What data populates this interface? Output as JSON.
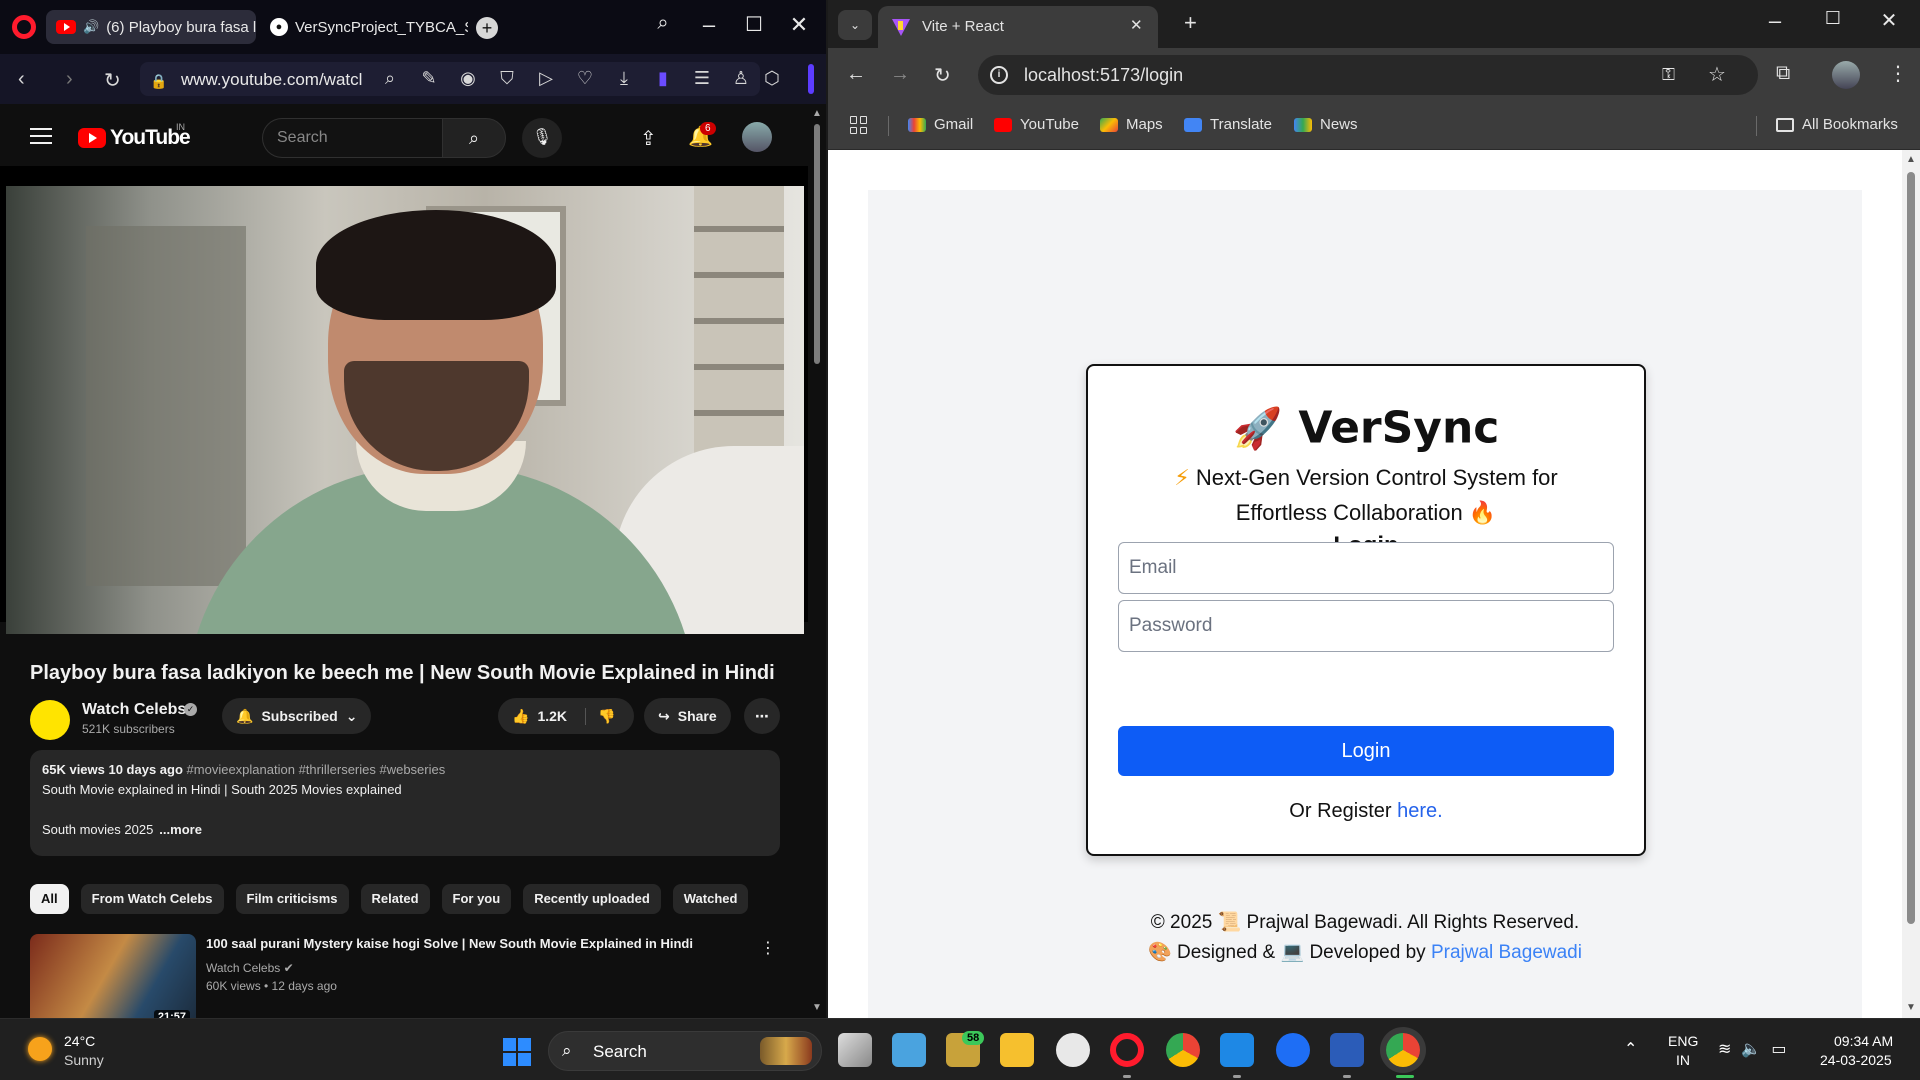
{
  "opera": {
    "tabs": [
      {
        "label": "(6) Playboy bura fasa l"
      },
      {
        "label": "VerSyncProject_TYBCA_SE"
      }
    ],
    "url": "www.youtube.com/watcl"
  },
  "youtube": {
    "logo_text": "YouTube",
    "country": "IN",
    "search_placeholder": "Search",
    "notification_count": "6",
    "video": {
      "title": "Playboy bura fasa ladkiyon ke beech me | New South Movie Explained in Hindi",
      "channel": "Watch Celebs",
      "subscribers": "521K subscribers",
      "subscribe_label": "Subscribed",
      "likes": "1.2K",
      "share_label": "Share"
    },
    "description": {
      "stats": "65K views  10 days ago",
      "tags": "#movieexplanation #thrillerseries #webseries",
      "line2": "South Movie explained in Hindi | South 2025 Movies explained",
      "line3": "South movies 2025",
      "more": "...more"
    },
    "chips": [
      "All",
      "From Watch Celebs",
      "Film criticisms",
      "Related",
      "For you",
      "Recently uploaded",
      "Watched"
    ],
    "recommendation": {
      "title": "100 saal purani Mystery kaise hogi Solve | New South Movie Explained in Hindi",
      "channel": "Watch Celebs",
      "meta": "60K views • 12 days ago",
      "duration": "21:57"
    }
  },
  "chrome": {
    "tab_title": "Vite + React",
    "url": "localhost:5173/login",
    "bookmarks": [
      "Gmail",
      "YouTube",
      "Maps",
      "Translate",
      "News"
    ],
    "all_bookmarks": "All Bookmarks"
  },
  "versync": {
    "brand": "VerSync",
    "tagline_line1": "Next-Gen Version Control System for",
    "tagline_line2": "Effortless Collaboration",
    "form_title": "Login",
    "email_placeholder": "Email",
    "password_placeholder": "Password",
    "login_button": "Login",
    "register_prefix": "Or Register",
    "register_link": "here.",
    "footer_line1": "© 2025 📜 Prajwal Bagewadi. All Rights Reserved.",
    "footer_designed": "Designed &",
    "footer_developed": "Developed by",
    "footer_author": "Prajwal Bagewadi",
    "primary_color": "#0d5cf6"
  },
  "taskbar": {
    "temperature": "24°C",
    "weather": "Sunny",
    "search": "Search",
    "mail_badge": "58",
    "lang": "ENG",
    "region": "IN",
    "time": "09:34 AM",
    "date": "24-03-2025"
  }
}
